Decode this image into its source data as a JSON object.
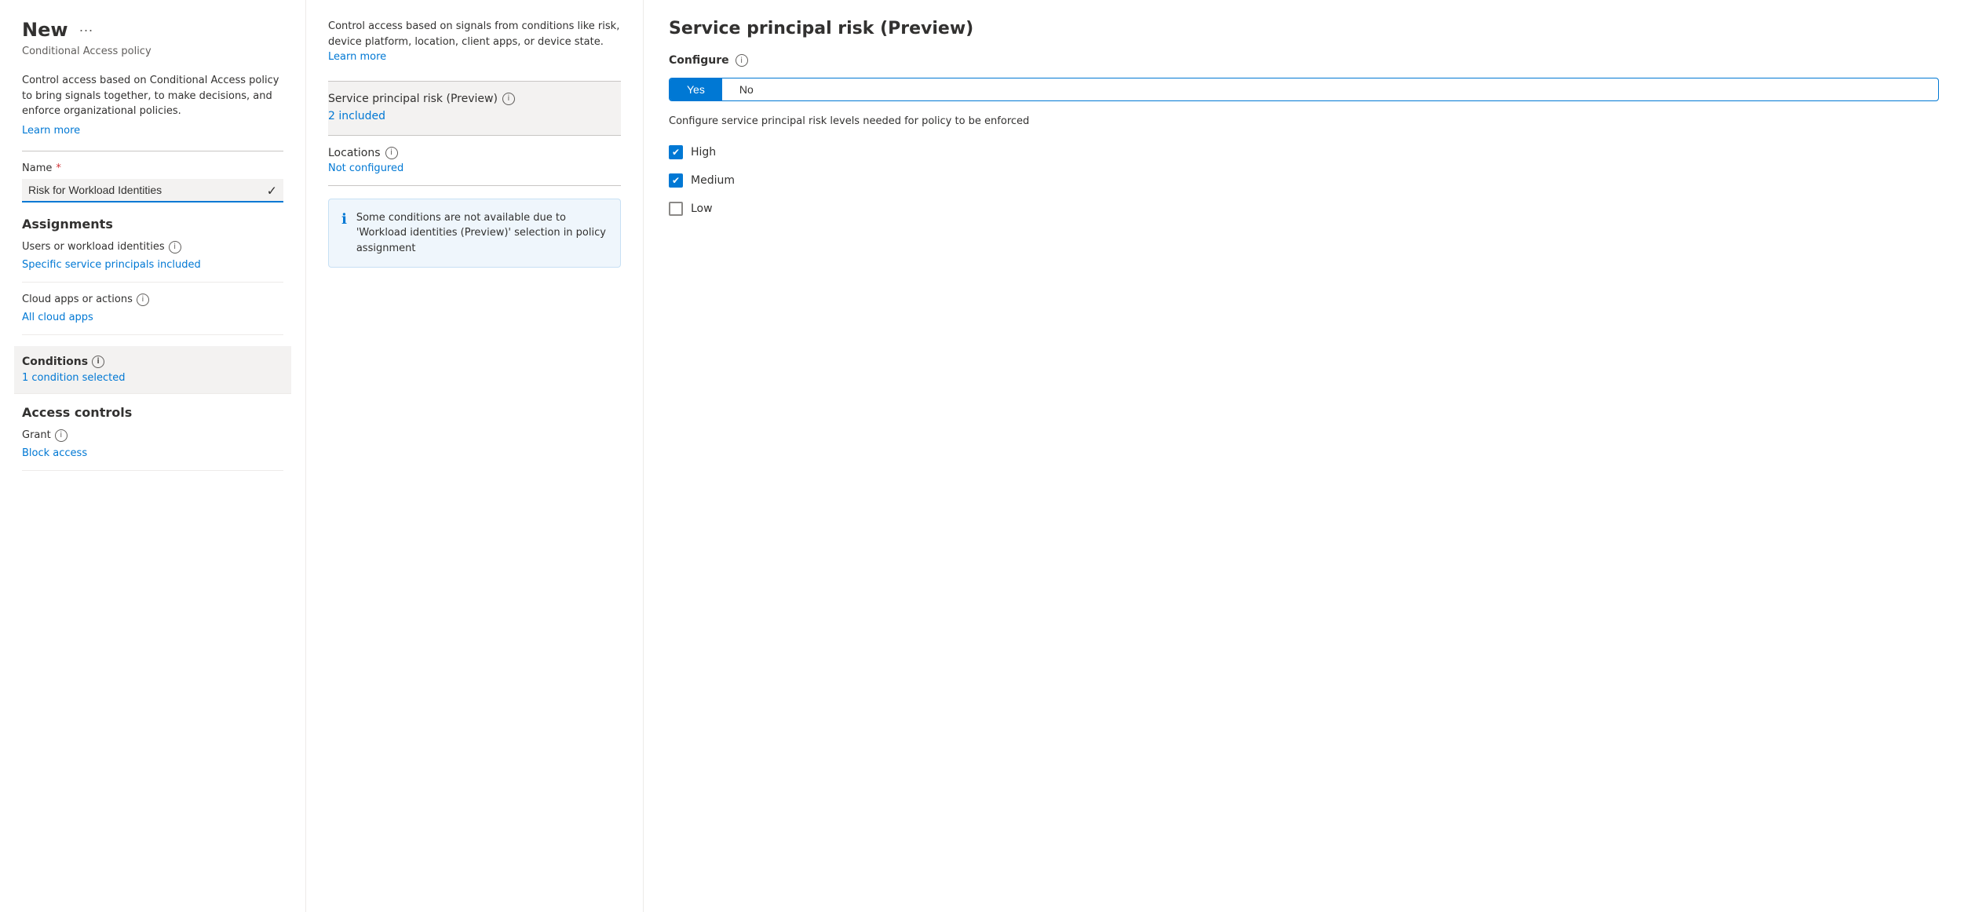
{
  "left": {
    "title": "New",
    "subtitle": "Conditional Access policy",
    "description": "Control access based on Conditional Access policy to bring signals together, to make decisions, and enforce organizational policies.",
    "learn_more": "Learn more",
    "name_label": "Name",
    "name_value": "Risk for Workload Identities",
    "assignments_title": "Assignments",
    "users_label": "Users or workload identities",
    "users_value": "Specific service principals included",
    "cloud_apps_label": "Cloud apps or actions",
    "cloud_apps_value": "All cloud apps",
    "conditions_title": "Conditions",
    "conditions_value": "1 condition selected",
    "access_controls_title": "Access controls",
    "grant_label": "Grant",
    "grant_value": "Block access"
  },
  "middle": {
    "description": "Control access based on signals from conditions like risk, device platform, location, client apps, or device state.",
    "learn_more": "Learn more",
    "service_principal_risk_label": "Service principal risk (Preview)",
    "service_principal_risk_value": "2 included",
    "locations_label": "Locations",
    "locations_value": "Not configured",
    "info_box_text": "Some conditions are not available due to 'Workload identities (Preview)' selection in policy assignment"
  },
  "right": {
    "title": "Service principal risk (Preview)",
    "configure_label": "Configure",
    "toggle_yes": "Yes",
    "toggle_no": "No",
    "configure_description": "Configure service principal risk levels needed for policy to be enforced",
    "checkboxes": [
      {
        "label": "High",
        "checked": true
      },
      {
        "label": "Medium",
        "checked": true
      },
      {
        "label": "Low",
        "checked": false
      }
    ]
  },
  "icons": {
    "info": "ⓘ",
    "check": "✓",
    "checkmark": "✔",
    "info_filled": "ℹ"
  }
}
